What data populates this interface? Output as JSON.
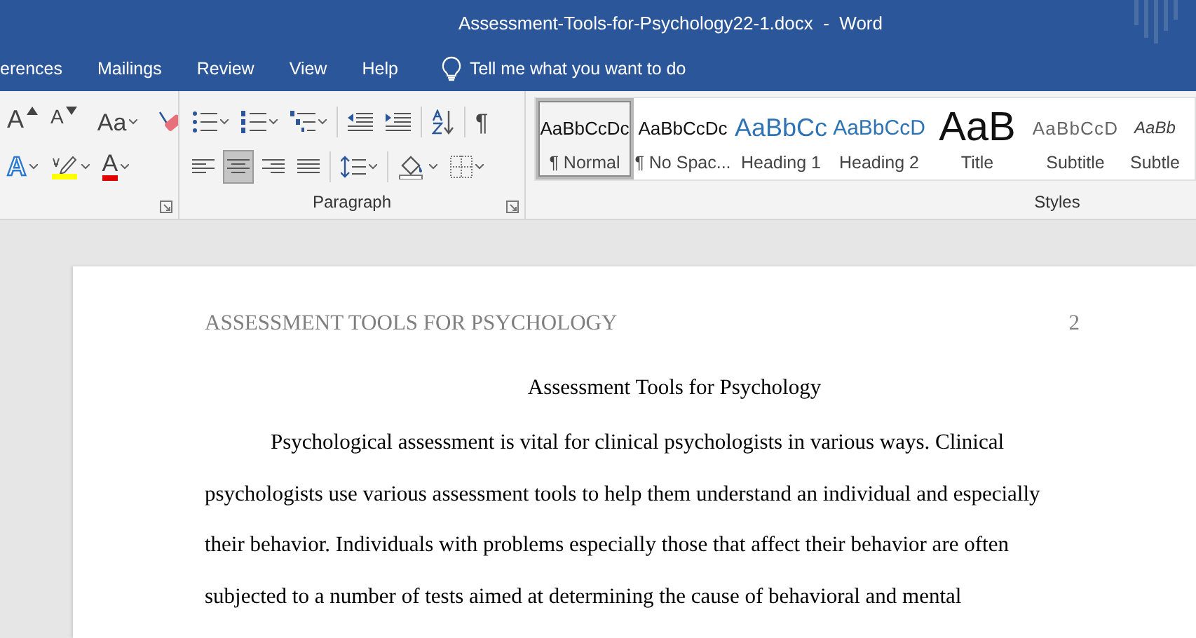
{
  "window": {
    "title": "Assessment-Tools-for-Psychology22-1.docx  -  Word"
  },
  "tabs": [
    {
      "label": "erences",
      "selected": false
    },
    {
      "label": "Mailings",
      "selected": false
    },
    {
      "label": "Review",
      "selected": false
    },
    {
      "label": "View",
      "selected": false
    },
    {
      "label": "Help",
      "selected": false
    }
  ],
  "tell_me": {
    "placeholder": "Tell me what you want to do"
  },
  "font_group": {
    "rows": [
      [
        {
          "kind": "grow-font",
          "text": "A",
          "selected": false
        },
        {
          "kind": "shrink-font",
          "text": "A",
          "selected": false
        },
        {
          "kind": "separator"
        },
        {
          "kind": "change-case",
          "text": "Aa",
          "selected": false
        },
        {
          "kind": "separator"
        },
        {
          "kind": "clear-format",
          "selected": false
        }
      ],
      [
        {
          "kind": "text-effects",
          "text": "A",
          "selected": false
        },
        {
          "kind": "highlight",
          "selected": false
        },
        {
          "kind": "font-color",
          "text": "A",
          "selected": false
        }
      ]
    ]
  },
  "paragraph_group": {
    "label": "Paragraph",
    "rows": [
      [
        {
          "kind": "bullets",
          "selected": false
        },
        {
          "kind": "numbering",
          "selected": false
        },
        {
          "kind": "multilevel",
          "selected": false
        },
        {
          "kind": "separator"
        },
        {
          "kind": "decrease-indent",
          "selected": false
        },
        {
          "kind": "increase-indent",
          "selected": false
        },
        {
          "kind": "separator"
        },
        {
          "kind": "sort",
          "selected": false
        },
        {
          "kind": "separator"
        },
        {
          "kind": "show-marks",
          "text": "¶",
          "selected": false
        }
      ],
      [
        {
          "kind": "align-left",
          "selected": false
        },
        {
          "kind": "align-center",
          "selected": true
        },
        {
          "kind": "align-right",
          "selected": false
        },
        {
          "kind": "justify",
          "selected": false
        },
        {
          "kind": "separator"
        },
        {
          "kind": "line-spacing",
          "selected": false
        },
        {
          "kind": "separator"
        },
        {
          "kind": "shading",
          "selected": false
        },
        {
          "kind": "borders",
          "selected": false
        }
      ]
    ]
  },
  "styles_group": {
    "label": "Styles",
    "items": [
      {
        "kind": "normal",
        "preview": "AaBbCcDc",
        "label": "¶ Normal",
        "selected": true
      },
      {
        "kind": "no-spacing",
        "preview": "AaBbCcDc",
        "label": "¶ No Spac...",
        "selected": false
      },
      {
        "kind": "heading1",
        "preview": "AaBbCc",
        "label": "Heading 1",
        "selected": false
      },
      {
        "kind": "heading2",
        "preview": "AaBbCcD",
        "label": "Heading 2",
        "selected": false
      },
      {
        "kind": "title",
        "preview": "AaB",
        "label": "Title",
        "selected": false
      },
      {
        "kind": "subtitle",
        "preview": "AaBbCcD",
        "label": "Subtitle",
        "selected": false
      },
      {
        "kind": "subtle",
        "preview": "AaBb",
        "label": "Subtle",
        "selected": false
      }
    ]
  },
  "document": {
    "header": "ASSESSMENT TOOLS FOR PSYCHOLOGY",
    "page_number": "2",
    "title": "Assessment Tools for Psychology",
    "paragraph": [
      "Psychological assessment is vital for clinical psychologists in various ways. Clinical",
      "psychologists use various assessment tools to help them understand an individual and especially",
      "their behavior. Individuals with problems especially those that affect their behavior are often",
      "subjected to a number of tests aimed at determining the cause of behavioral and mental"
    ]
  }
}
